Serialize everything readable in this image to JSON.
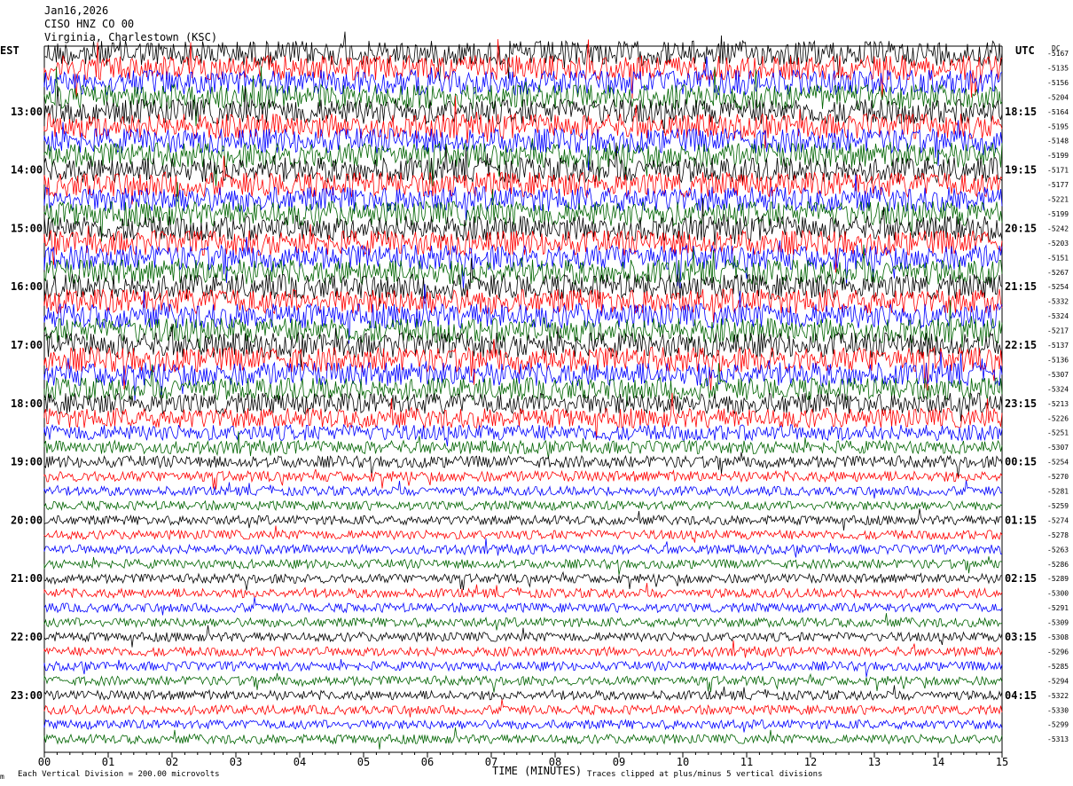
{
  "header": {
    "date": "Jan16,2026",
    "channel": "CISO HNZ CO 00",
    "location": "Virginia, Charlestown (KSC)"
  },
  "left_zone": "EST",
  "right_zone": "UTC",
  "dc_label": "DC",
  "footer": {
    "scale": "Each Vertical Division =  200.00 microvolts",
    "clip": "Traces clipped at plus/minus 5 vertical divisions",
    "corner": "m"
  },
  "chart_data": {
    "type": "helicorder",
    "xlabel": "TIME (MINUTES)",
    "xlim": [
      0,
      15
    ],
    "x_ticks": [
      "00",
      "01",
      "02",
      "03",
      "04",
      "05",
      "06",
      "07",
      "08",
      "09",
      "10",
      "11",
      "12",
      "13",
      "14",
      "15"
    ],
    "trace_colors": [
      "#000000",
      "#ff0000",
      "#0000ff",
      "#006400"
    ],
    "left_time_labels": [
      "13:00",
      "14:00",
      "15:00",
      "16:00",
      "17:00",
      "18:00",
      "19:00",
      "20:00",
      "21:00",
      "22:00",
      "23:00"
    ],
    "right_time_labels": [
      "18:15",
      "19:15",
      "20:15",
      "21:15",
      "22:15",
      "23:15",
      "00:15",
      "01:15",
      "02:15",
      "03:15",
      "04:15"
    ],
    "dc_offsets": [
      -5167,
      -5135,
      -5156,
      -5204,
      -5164,
      -5195,
      -5148,
      -5199,
      -5171,
      -5177,
      -5221,
      -5199,
      -5242,
      -5203,
      -5151,
      -5267,
      -5254,
      -5332,
      -5324,
      -5217,
      -5137,
      -5136,
      -5307,
      -5324,
      -5213,
      -5226,
      -5251,
      -5307,
      -5254,
      -5270,
      -5281,
      -5259,
      -5274,
      -5278,
      -5263,
      -5286,
      -5289,
      -5300,
      -5291,
      -5309,
      -5308,
      -5296,
      -5285,
      -5294,
      -5322,
      -5330,
      -5299,
      -5313
    ],
    "trace_amplitudes": [
      0.95,
      0.95,
      0.95,
      0.95,
      0.95,
      0.95,
      0.95,
      0.95,
      0.95,
      0.95,
      0.95,
      0.95,
      0.95,
      0.95,
      0.95,
      0.95,
      0.95,
      0.95,
      0.95,
      0.95,
      0.95,
      0.95,
      0.9,
      0.85,
      0.8,
      0.75,
      0.6,
      0.5,
      0.45,
      0.4,
      0.35,
      0.35,
      0.35,
      0.35,
      0.35,
      0.35,
      0.35,
      0.35,
      0.35,
      0.35,
      0.35,
      0.35,
      0.35,
      0.35,
      0.35,
      0.35,
      0.35,
      0.35
    ]
  }
}
